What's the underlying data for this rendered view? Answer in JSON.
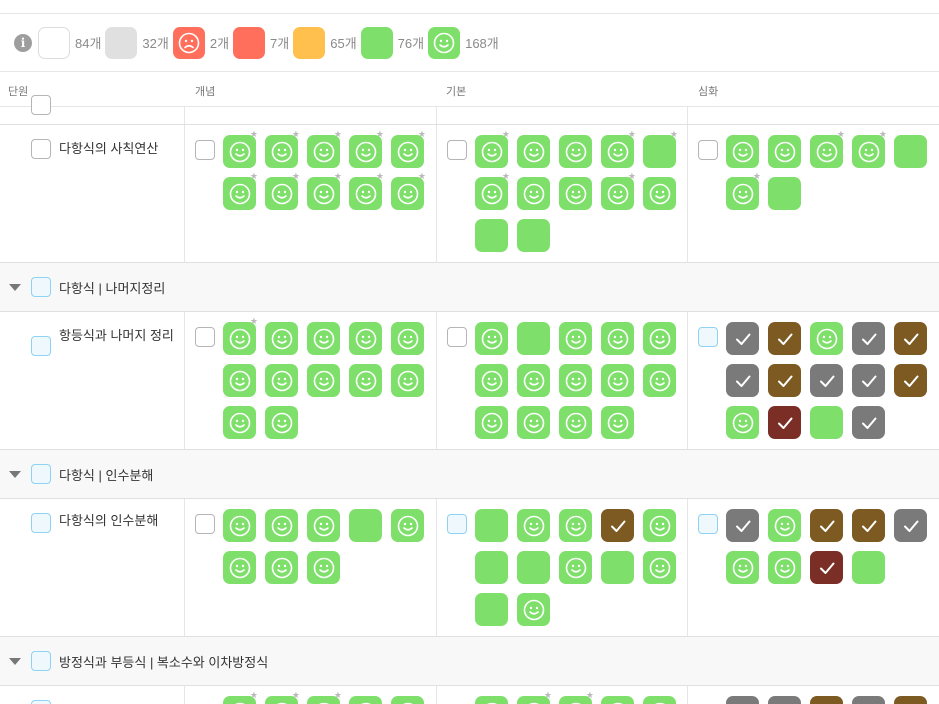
{
  "legend": {
    "items": [
      {
        "kind": "white",
        "count": "84개"
      },
      {
        "kind": "gray",
        "count": "32개"
      },
      {
        "kind": "sad",
        "count": "2개"
      },
      {
        "kind": "orange",
        "count": "7개"
      },
      {
        "kind": "yellow",
        "count": "65개"
      },
      {
        "kind": "green",
        "count": "76개"
      },
      {
        "kind": "smile",
        "count": "168개"
      }
    ],
    "colors": {
      "white": "#ffffff",
      "gray": "#e0e0e0",
      "sad": "#ff6f5c",
      "orange": "#ff6f5c",
      "yellow": "#ffc04d",
      "green": "#7ee06a",
      "smile": "#7ee06a"
    }
  },
  "header": {
    "col_unit": "단원",
    "col_a": "개념",
    "col_b": "기본",
    "col_c": "심화"
  },
  "rows": [
    {
      "label": "다항식의 사칙연산",
      "a": [
        "ss",
        "ss",
        "ss",
        "ss",
        "ss",
        "ss",
        "ss",
        "ss",
        "ss",
        "ss"
      ],
      "b": [
        "ss",
        "s",
        "s",
        "ss",
        "gs",
        "ss",
        "s",
        "s",
        "ss",
        "s",
        "g",
        "g"
      ],
      "c": [
        "s",
        "s",
        "ss",
        "ss",
        "g",
        "ss",
        "g"
      ]
    },
    {
      "label": "항등식과 나머지 정리",
      "a": [
        "ss",
        "s",
        "s",
        "s",
        "s",
        "s",
        "s",
        "s",
        "s",
        "s",
        "s",
        "s"
      ],
      "b": [
        "s",
        "g",
        "s",
        "s",
        "s",
        "s",
        "s",
        "s",
        "s",
        "s",
        "s",
        "s",
        "s",
        "s"
      ],
      "c": [
        "gr",
        "br",
        "s",
        "gr",
        "br",
        "gr",
        "br",
        "gr",
        "gr",
        "br",
        "s",
        "rd",
        "g",
        "gr"
      ]
    },
    {
      "label": "다항식의 인수분해",
      "a": [
        "s",
        "s",
        "s",
        "g",
        "s",
        "s",
        "s",
        "s"
      ],
      "b": [
        "g",
        "s",
        "s",
        "br",
        "s",
        "g",
        "g",
        "s",
        "g",
        "s",
        "g",
        "s"
      ],
      "c": [
        "gr",
        "s",
        "br",
        "br",
        "gr",
        "s",
        "s",
        "rd",
        "g"
      ]
    }
  ],
  "sections": [
    {
      "title": "다항식 | 나머지정리"
    },
    {
      "title": "다항식 | 인수분해"
    },
    {
      "title": "방정식과 부등식 | 복소수와 이차방정식"
    }
  ]
}
